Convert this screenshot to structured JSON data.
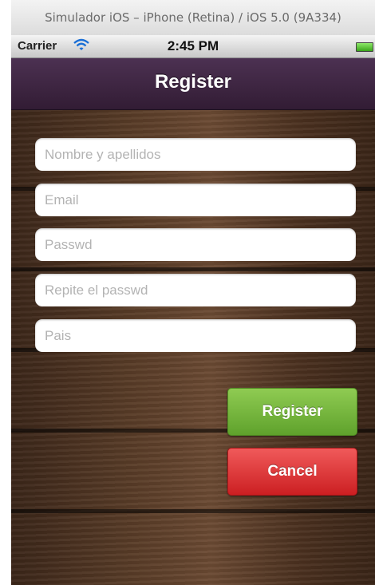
{
  "simulator": {
    "title": "Simulador iOS – iPhone (Retina) / iOS 5.0 (9A334)"
  },
  "statusbar": {
    "carrier": "Carrier",
    "time": "2:45 PM",
    "icons": [
      "wifi-icon",
      "battery-icon"
    ]
  },
  "navbar": {
    "title": "Register",
    "color": "#3f2643"
  },
  "form": {
    "fields": [
      {
        "placeholder": "Nombre y apellidos",
        "value": ""
      },
      {
        "placeholder": "Email",
        "value": ""
      },
      {
        "placeholder": "Passwd",
        "value": ""
      },
      {
        "placeholder": "Repite el passwd",
        "value": ""
      },
      {
        "placeholder": "Pais",
        "value": ""
      }
    ]
  },
  "buttons": {
    "register_label": "Register",
    "register_color": "#6fb23a",
    "cancel_label": "Cancel",
    "cancel_color": "#e0393b"
  }
}
